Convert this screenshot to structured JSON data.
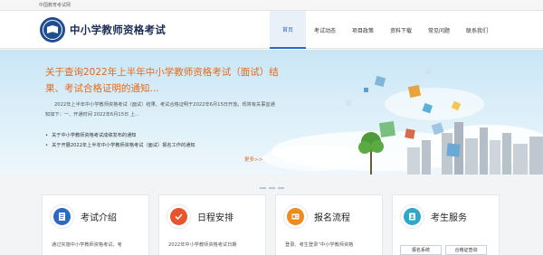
{
  "topbar": {
    "org": "中国教育考试网"
  },
  "header": {
    "title": "中小学教师资格考试"
  },
  "nav": [
    {
      "label": "首页",
      "active": true
    },
    {
      "label": "考试动态",
      "active": false
    },
    {
      "label": "项目政策",
      "active": false
    },
    {
      "label": "资料下载",
      "active": false
    },
    {
      "label": "常见问题",
      "active": false
    },
    {
      "label": "联系我们",
      "active": false
    }
  ],
  "banner": {
    "title": "关于查询2022年上半年中小学教师资格考试（面试）结果、考试合格证明的通知...",
    "summary": "2022年上半年中小学教师资格考试（面试）结果、考试合格证明于2022年6月15日开放。现将有关事宜通知如下：一、开通时间  2022年6月15日 上...",
    "list": [
      "关于中小学教师资格考试成绩发布的通知",
      "关于开展2022年上半年中小学教师资格考试（面试）报名工作的通知"
    ],
    "more": "更多>>"
  },
  "cards": [
    {
      "title": "考试介绍",
      "desc": "通过实施中小学教师资格考试，考",
      "icon": "document-icon",
      "color": "#2a6ac4"
    },
    {
      "title": "日程安排",
      "desc": "2022年中小学教师资格考试日期",
      "icon": "checkmark-icon",
      "color": "#e8542b"
    },
    {
      "title": "报名流程",
      "desc": "登录。考生登录“中小学教师资格",
      "icon": "registration-icon",
      "color": "#f08a1c"
    },
    {
      "title": "考生服务",
      "icon": "person-id-icon",
      "color": "#2fa8c8",
      "buttons": [
        "报名系统",
        "合格证查询"
      ]
    }
  ]
}
